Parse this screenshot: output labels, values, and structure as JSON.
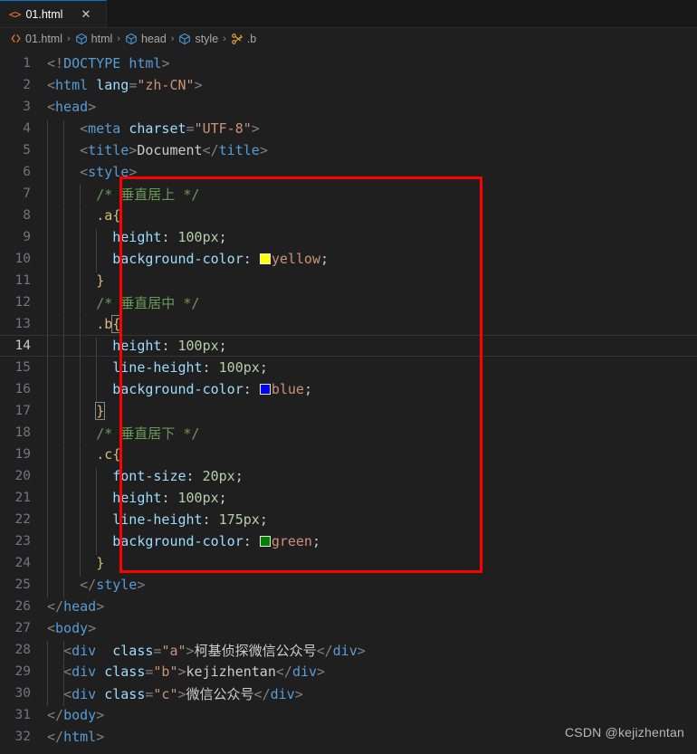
{
  "tab": {
    "icon": "html-file-icon",
    "label": "01.html",
    "close": "✕"
  },
  "breadcrumbs": [
    {
      "icon": "html-file-icon",
      "label": "01.html"
    },
    {
      "icon": "symbol-module-icon",
      "label": "html"
    },
    {
      "icon": "symbol-module-icon",
      "label": "head"
    },
    {
      "icon": "symbol-module-icon",
      "label": "style"
    },
    {
      "icon": "symbol-ruler-icon",
      "label": ".b"
    }
  ],
  "breadcrumb_separator": "›",
  "editor": {
    "current_line": 14,
    "line_count": 32,
    "lines": [
      {
        "n": 1,
        "tokens": [
          {
            "c": "t-punc",
            "t": "<!"
          },
          {
            "c": "t-doctype",
            "t": "DOCTYPE"
          },
          {
            "c": "t-txt",
            "t": " "
          },
          {
            "c": "t-tag",
            "t": "html"
          },
          {
            "c": "t-punc",
            "t": ">"
          }
        ]
      },
      {
        "n": 2,
        "tokens": [
          {
            "c": "t-punc",
            "t": "<"
          },
          {
            "c": "t-tag",
            "t": "html"
          },
          {
            "c": "t-txt",
            "t": " "
          },
          {
            "c": "t-attr",
            "t": "lang"
          },
          {
            "c": "t-punc",
            "t": "="
          },
          {
            "c": "t-str",
            "t": "\"zh-CN\""
          },
          {
            "c": "t-punc",
            "t": ">"
          }
        ]
      },
      {
        "n": 3,
        "tokens": [
          {
            "c": "t-punc",
            "t": "<"
          },
          {
            "c": "t-tag",
            "t": "head"
          },
          {
            "c": "t-punc",
            "t": ">"
          }
        ]
      },
      {
        "n": 4,
        "indent": 2,
        "tokens": [
          {
            "c": "t-txt",
            "t": "    "
          },
          {
            "c": "t-punc",
            "t": "<"
          },
          {
            "c": "t-tag",
            "t": "meta"
          },
          {
            "c": "t-txt",
            "t": " "
          },
          {
            "c": "t-attr",
            "t": "charset"
          },
          {
            "c": "t-punc",
            "t": "="
          },
          {
            "c": "t-str",
            "t": "\"UTF-8\""
          },
          {
            "c": "t-punc",
            "t": ">"
          }
        ]
      },
      {
        "n": 5,
        "indent": 2,
        "tokens": [
          {
            "c": "t-txt",
            "t": "    "
          },
          {
            "c": "t-punc",
            "t": "<"
          },
          {
            "c": "t-tag",
            "t": "title"
          },
          {
            "c": "t-punc",
            "t": ">"
          },
          {
            "c": "t-txt",
            "t": "Document"
          },
          {
            "c": "t-punc",
            "t": "</"
          },
          {
            "c": "t-tag",
            "t": "title"
          },
          {
            "c": "t-punc",
            "t": ">"
          }
        ]
      },
      {
        "n": 6,
        "indent": 2,
        "tokens": [
          {
            "c": "t-txt",
            "t": "    "
          },
          {
            "c": "t-punc",
            "t": "<"
          },
          {
            "c": "t-tag",
            "t": "style"
          },
          {
            "c": "t-punc",
            "t": ">"
          }
        ]
      },
      {
        "n": 7,
        "indent": 3,
        "tokens": [
          {
            "c": "t-txt",
            "t": "      "
          },
          {
            "c": "t-comment",
            "t": "/* "
          },
          {
            "c": "t-comment t-cn",
            "t": "垂直居上"
          },
          {
            "c": "t-comment",
            "t": " */"
          }
        ]
      },
      {
        "n": 8,
        "indent": 3,
        "tokens": [
          {
            "c": "t-txt",
            "t": "      "
          },
          {
            "c": "t-sel",
            "t": ".a"
          },
          {
            "c": "t-brace",
            "t": "{"
          }
        ]
      },
      {
        "n": 9,
        "indent": 4,
        "tokens": [
          {
            "c": "t-txt",
            "t": "        "
          },
          {
            "c": "t-prop",
            "t": "height"
          },
          {
            "c": "t-semi",
            "t": ": "
          },
          {
            "c": "t-num",
            "t": "100px"
          },
          {
            "c": "t-semi",
            "t": ";"
          }
        ]
      },
      {
        "n": 10,
        "indent": 4,
        "tokens": [
          {
            "c": "t-txt",
            "t": "        "
          },
          {
            "c": "t-prop",
            "t": "background-color"
          },
          {
            "c": "t-semi",
            "t": ": "
          },
          {
            "c": "swatch",
            "t": "",
            "color": "#ffff00"
          },
          {
            "c": "t-val",
            "t": "yellow"
          },
          {
            "c": "t-semi",
            "t": ";"
          }
        ]
      },
      {
        "n": 11,
        "indent": 3,
        "tokens": [
          {
            "c": "t-txt",
            "t": "      "
          },
          {
            "c": "t-brace",
            "t": "}"
          }
        ]
      },
      {
        "n": 12,
        "indent": 3,
        "tokens": [
          {
            "c": "t-txt",
            "t": "      "
          },
          {
            "c": "t-comment",
            "t": "/* "
          },
          {
            "c": "t-comment t-cn",
            "t": "垂直居中"
          },
          {
            "c": "t-comment",
            "t": " */"
          }
        ]
      },
      {
        "n": 13,
        "indent": 3,
        "tokens": [
          {
            "c": "t-txt",
            "t": "      "
          },
          {
            "c": "t-sel",
            "t": ".b"
          },
          {
            "c": "t-brace brace-match",
            "t": "{"
          }
        ]
      },
      {
        "n": 14,
        "indent": 4,
        "tokens": [
          {
            "c": "t-txt",
            "t": "        "
          },
          {
            "c": "t-prop",
            "t": "height"
          },
          {
            "c": "t-semi",
            "t": ": "
          },
          {
            "c": "t-num",
            "t": "100px"
          },
          {
            "c": "t-semi",
            "t": ";"
          }
        ]
      },
      {
        "n": 15,
        "indent": 4,
        "tokens": [
          {
            "c": "t-txt",
            "t": "        "
          },
          {
            "c": "t-prop",
            "t": "line-height"
          },
          {
            "c": "t-semi",
            "t": ": "
          },
          {
            "c": "t-num",
            "t": "100px"
          },
          {
            "c": "t-semi",
            "t": ";"
          }
        ]
      },
      {
        "n": 16,
        "indent": 4,
        "tokens": [
          {
            "c": "t-txt",
            "t": "        "
          },
          {
            "c": "t-prop",
            "t": "background-color"
          },
          {
            "c": "t-semi",
            "t": ": "
          },
          {
            "c": "swatch",
            "t": "",
            "color": "#0000ff"
          },
          {
            "c": "t-val",
            "t": "blue"
          },
          {
            "c": "t-semi",
            "t": ";"
          }
        ]
      },
      {
        "n": 17,
        "indent": 3,
        "tokens": [
          {
            "c": "t-txt",
            "t": "      "
          },
          {
            "c": "t-brace brace-match",
            "t": "}"
          }
        ]
      },
      {
        "n": 18,
        "indent": 3,
        "tokens": [
          {
            "c": "t-txt",
            "t": "      "
          },
          {
            "c": "t-comment",
            "t": "/* "
          },
          {
            "c": "t-comment t-cn",
            "t": "垂直居下"
          },
          {
            "c": "t-comment",
            "t": " */"
          }
        ]
      },
      {
        "n": 19,
        "indent": 3,
        "tokens": [
          {
            "c": "t-txt",
            "t": "      "
          },
          {
            "c": "t-sel",
            "t": ".c"
          },
          {
            "c": "t-brace",
            "t": "{"
          }
        ]
      },
      {
        "n": 20,
        "indent": 4,
        "tokens": [
          {
            "c": "t-txt",
            "t": "        "
          },
          {
            "c": "t-prop",
            "t": "font-size"
          },
          {
            "c": "t-semi",
            "t": ": "
          },
          {
            "c": "t-num",
            "t": "20px"
          },
          {
            "c": "t-semi",
            "t": ";"
          }
        ]
      },
      {
        "n": 21,
        "indent": 4,
        "tokens": [
          {
            "c": "t-txt",
            "t": "        "
          },
          {
            "c": "t-prop",
            "t": "height"
          },
          {
            "c": "t-semi",
            "t": ": "
          },
          {
            "c": "t-num",
            "t": "100px"
          },
          {
            "c": "t-semi",
            "t": ";"
          }
        ]
      },
      {
        "n": 22,
        "indent": 4,
        "tokens": [
          {
            "c": "t-txt",
            "t": "        "
          },
          {
            "c": "t-prop",
            "t": "line-height"
          },
          {
            "c": "t-semi",
            "t": ": "
          },
          {
            "c": "t-num",
            "t": "175px"
          },
          {
            "c": "t-semi",
            "t": ";"
          }
        ]
      },
      {
        "n": 23,
        "indent": 4,
        "tokens": [
          {
            "c": "t-txt",
            "t": "        "
          },
          {
            "c": "t-prop",
            "t": "background-color"
          },
          {
            "c": "t-semi",
            "t": ": "
          },
          {
            "c": "swatch",
            "t": "",
            "color": "#008000"
          },
          {
            "c": "t-val",
            "t": "green"
          },
          {
            "c": "t-semi",
            "t": ";"
          }
        ]
      },
      {
        "n": 24,
        "indent": 3,
        "tokens": [
          {
            "c": "t-txt",
            "t": "      "
          },
          {
            "c": "t-brace",
            "t": "}"
          }
        ]
      },
      {
        "n": 25,
        "indent": 2,
        "tokens": [
          {
            "c": "t-txt",
            "t": "    "
          },
          {
            "c": "t-punc",
            "t": "</"
          },
          {
            "c": "t-tag",
            "t": "style"
          },
          {
            "c": "t-punc",
            "t": ">"
          }
        ]
      },
      {
        "n": 26,
        "tokens": [
          {
            "c": "t-punc",
            "t": "</"
          },
          {
            "c": "t-tag",
            "t": "head"
          },
          {
            "c": "t-punc",
            "t": ">"
          }
        ]
      },
      {
        "n": 27,
        "tokens": [
          {
            "c": "t-punc",
            "t": "<"
          },
          {
            "c": "t-tag",
            "t": "body"
          },
          {
            "c": "t-punc",
            "t": ">"
          }
        ]
      },
      {
        "n": 28,
        "indent": 2,
        "tokens": [
          {
            "c": "t-txt",
            "t": "  "
          },
          {
            "c": "t-punc",
            "t": "<"
          },
          {
            "c": "t-tag",
            "t": "div"
          },
          {
            "c": "t-txt",
            "t": "  "
          },
          {
            "c": "t-attr",
            "t": "class"
          },
          {
            "c": "t-punc",
            "t": "="
          },
          {
            "c": "t-str",
            "t": "\"a\""
          },
          {
            "c": "t-punc",
            "t": ">"
          },
          {
            "c": "t-txt t-cn",
            "t": "柯基侦探微信公众号"
          },
          {
            "c": "t-punc",
            "t": "</"
          },
          {
            "c": "t-tag",
            "t": "div"
          },
          {
            "c": "t-punc",
            "t": ">"
          }
        ]
      },
      {
        "n": 29,
        "indent": 2,
        "tokens": [
          {
            "c": "t-txt",
            "t": "  "
          },
          {
            "c": "t-punc",
            "t": "<"
          },
          {
            "c": "t-tag",
            "t": "div"
          },
          {
            "c": "t-txt",
            "t": " "
          },
          {
            "c": "t-attr",
            "t": "class"
          },
          {
            "c": "t-punc",
            "t": "="
          },
          {
            "c": "t-str",
            "t": "\"b\""
          },
          {
            "c": "t-punc",
            "t": ">"
          },
          {
            "c": "t-txt",
            "t": "kejizhentan"
          },
          {
            "c": "t-punc",
            "t": "</"
          },
          {
            "c": "t-tag",
            "t": "div"
          },
          {
            "c": "t-punc",
            "t": ">"
          }
        ]
      },
      {
        "n": 30,
        "indent": 2,
        "tokens": [
          {
            "c": "t-txt",
            "t": "  "
          },
          {
            "c": "t-punc",
            "t": "<"
          },
          {
            "c": "t-tag",
            "t": "div"
          },
          {
            "c": "t-txt",
            "t": " "
          },
          {
            "c": "t-attr",
            "t": "class"
          },
          {
            "c": "t-punc",
            "t": "="
          },
          {
            "c": "t-str",
            "t": "\"c\""
          },
          {
            "c": "t-punc",
            "t": ">"
          },
          {
            "c": "t-txt t-cn",
            "t": "微信公众号"
          },
          {
            "c": "t-punc",
            "t": "</"
          },
          {
            "c": "t-tag",
            "t": "div"
          },
          {
            "c": "t-punc",
            "t": ">"
          }
        ]
      },
      {
        "n": 31,
        "tokens": [
          {
            "c": "t-punc",
            "t": "</"
          },
          {
            "c": "t-tag",
            "t": "body"
          },
          {
            "c": "t-punc",
            "t": ">"
          }
        ]
      },
      {
        "n": 32,
        "tokens": [
          {
            "c": "t-punc",
            "t": "</"
          },
          {
            "c": "t-tag",
            "t": "html"
          },
          {
            "c": "t-punc",
            "t": ">"
          }
        ]
      }
    ]
  },
  "annotation": {
    "type": "red-rectangle-highlight",
    "color": "#ff0000",
    "covers_lines": "7-24"
  },
  "watermark": "CSDN @kejizhentan",
  "colors": {
    "editor_background": "#1f1f1f",
    "tabbar_background": "#181818",
    "active_tab_top_border": "#0078d4",
    "line_number": "#6e7681",
    "comment": "#6a9955",
    "tag": "#569cd6",
    "attribute": "#9cdcfe",
    "string": "#ce9178",
    "number": "#b5cea8",
    "selector": "#d7ba7d",
    "swatch_yellow": "#ffff00",
    "swatch_blue": "#0000ff",
    "swatch_green": "#008000"
  }
}
